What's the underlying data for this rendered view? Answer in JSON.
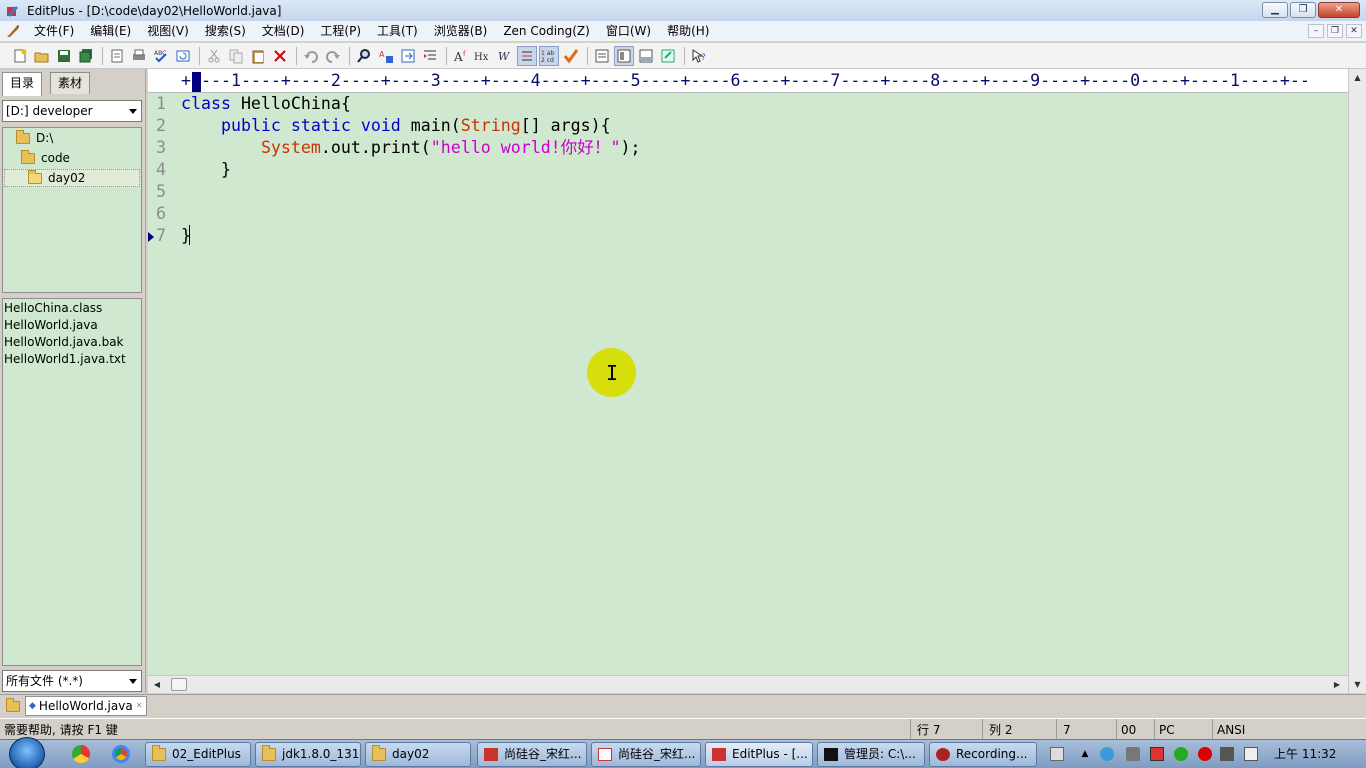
{
  "window": {
    "title": "EditPlus - [D:\\code\\day02\\HelloWorld.java]"
  },
  "menu": [
    "文件(F)",
    "编辑(E)",
    "视图(V)",
    "搜索(S)",
    "文档(D)",
    "工程(P)",
    "工具(T)",
    "浏览器(B)",
    "Zen Coding(Z)",
    "窗口(W)",
    "帮助(H)"
  ],
  "sidebar": {
    "tabs": [
      "目录",
      "素材"
    ],
    "drive": "[D:] developer",
    "tree": [
      "D:\\",
      "code",
      "day02"
    ],
    "files": [
      "HelloChina.class",
      "HelloWorld.java",
      "HelloWorld.java.bak",
      "HelloWorld1.java.txt"
    ],
    "filter": "所有文件 (*.*)"
  },
  "ruler": "+----1----+----2----+----3----+----4----+----5----+----6----+----7----+----8----+----9----+----0----+----1----+--",
  "editor": {
    "line_numbers": [
      "1",
      "2",
      "3",
      "4",
      "5",
      "6",
      "7"
    ],
    "lines": [
      [
        {
          "t": "class HelloChina{",
          "c": "kw-lead"
        }
      ],
      [
        {
          "t": "    ",
          "c": ""
        },
        {
          "t": "public static void",
          "c": "kw"
        },
        {
          "t": " main(",
          "c": ""
        },
        {
          "t": "String",
          "c": "cls"
        },
        {
          "t": "[] args){",
          "c": ""
        }
      ],
      [
        {
          "t": "        ",
          "c": ""
        },
        {
          "t": "System",
          "c": "cls"
        },
        {
          "t": ".out.print(",
          "c": ""
        },
        {
          "t": "\"hello world!你好！\"",
          "c": "str"
        },
        {
          "t": ");",
          "c": ""
        }
      ],
      [
        {
          "t": "    }",
          "c": ""
        }
      ],
      [
        {
          "t": "",
          "c": ""
        }
      ],
      [
        {
          "t": "",
          "c": ""
        }
      ],
      [
        {
          "t": "}",
          "c": ""
        }
      ]
    ]
  },
  "doc_tab": {
    "label": "HelloWorld.java"
  },
  "status": {
    "help": "需要帮助, 请按 F1 键",
    "row": "行 7",
    "col": "列 2",
    "pos": "7",
    "code": "00",
    "mode": "PC",
    "encoding": "ANSI"
  },
  "taskbar": {
    "buttons": [
      "02_EditPlus",
      "jdk1.8.0_131",
      "day02",
      "尚硅谷_宋红...",
      "尚硅谷_宋红...",
      "EditPlus - [...",
      "管理员: C:\\...",
      "Recording..."
    ],
    "clock": "上午 11:32"
  },
  "colors": {
    "editor_bg": "#cfe8cf",
    "keyword": "#0000cc",
    "class": "#cc3300",
    "string": "#cc00cc",
    "cursor_highlight": "#d6de00"
  },
  "icons": [
    "editplus-app-icon",
    "pen-icon",
    "new-file-icon",
    "open-folder-icon",
    "save-icon",
    "save-all-icon",
    "print-preview-icon",
    "print-icon",
    "spellcheck-icon",
    "refresh-icon",
    "cut-icon",
    "copy-icon",
    "paste-icon",
    "delete-icon",
    "undo-icon",
    "redo-icon",
    "find-icon",
    "replace-icon",
    "goto-icon",
    "indent-icon",
    "font-icon",
    "hex-icon",
    "word-wrap-icon",
    "line-number-icon",
    "column-mode-icon",
    "check-icon",
    "view-icon",
    "browser-icon",
    "output-icon",
    "help-icon"
  ]
}
